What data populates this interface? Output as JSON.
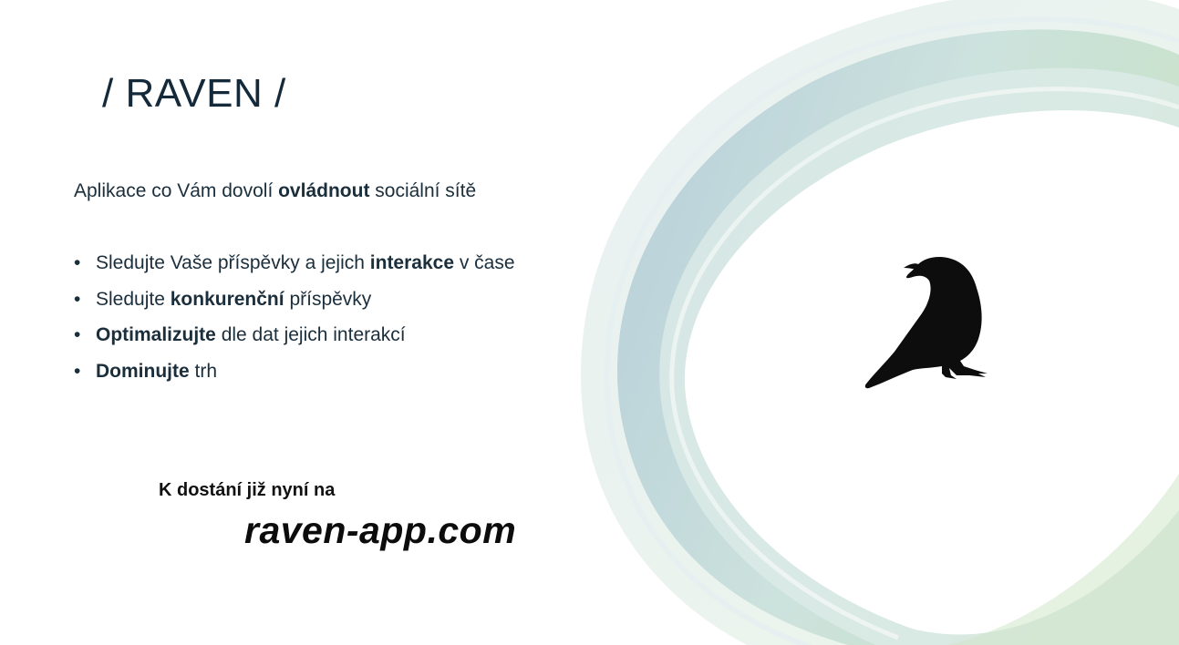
{
  "slide": {
    "title": "/ RAVEN /",
    "tagline": {
      "before": "Aplikace co Vám dovolí ",
      "bold": "ovládnout",
      "after": " sociální sítě"
    },
    "bullets": [
      {
        "before": "Sledujte Vaše příspěvky a jejich ",
        "bold": "interakce",
        "after": " v čase"
      },
      {
        "before": "Sledujte ",
        "bold": "konkurenční",
        "after": " příspěvky"
      },
      {
        "before": "",
        "bold": "Optimalizujte",
        "after": " dle dat jejich interakcí"
      },
      {
        "before": "",
        "bold": "Dominujte",
        "after": " trh"
      }
    ],
    "bullet_glyph": "•",
    "cta": {
      "label": "K dostání již nyní na",
      "url_text": "raven-app.com"
    },
    "logo_icon": "raven-icon",
    "colors": {
      "text": "#1b2e3c",
      "ring_blue": "#a9c6d2",
      "ring_green": "#b9dbb4"
    }
  }
}
